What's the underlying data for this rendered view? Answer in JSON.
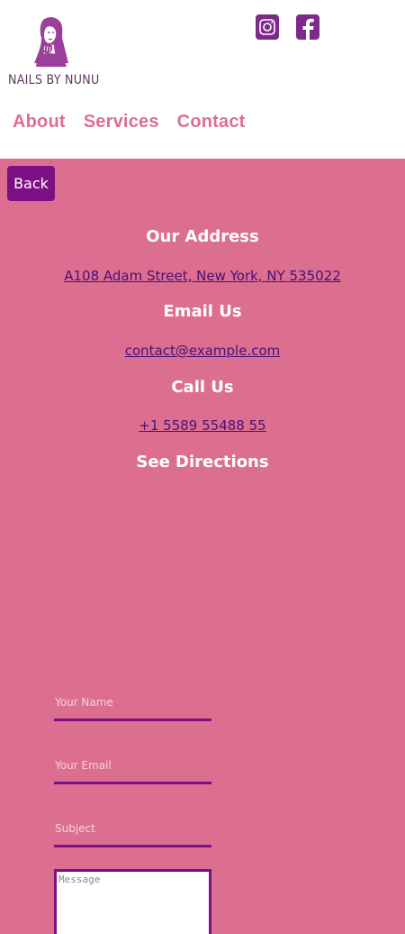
{
  "brand": {
    "name": "NAILS BY NUNU",
    "colors": {
      "pink": "#dc6f8f",
      "purple": "#7d0f84",
      "link": "#4a0f7a"
    }
  },
  "social": [
    {
      "icon": "instagram-icon"
    },
    {
      "icon": "facebook-icon"
    }
  ],
  "nav": {
    "items": [
      "About",
      "Services",
      "Contact"
    ]
  },
  "back_label": "Back",
  "contact": {
    "address_heading": "Our Address",
    "address": "A108 Adam Street, New York, NY 535022",
    "email_heading": "Email Us",
    "email": "contact@example.com",
    "call_heading": "Call Us",
    "phone": "+1 5589 55488 55",
    "directions_heading": "See Directions"
  },
  "form": {
    "name_placeholder": "Your Name",
    "email_placeholder": "Your Email",
    "subject_placeholder": "Subject",
    "message_placeholder": "Message"
  }
}
